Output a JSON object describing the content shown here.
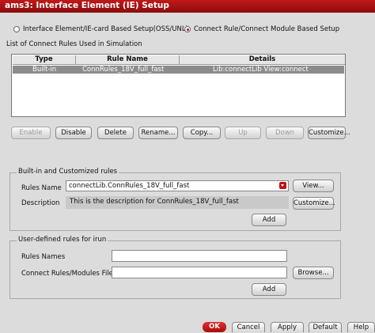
{
  "window": {
    "title": "ams3: Interface Element (IE) Setup"
  },
  "setup_mode": {
    "options": [
      {
        "label": "Interface Element/IE-card Based Setup(OSS/UNL)",
        "selected": false
      },
      {
        "label": "Connect Rule/Connect Module Based Setup",
        "selected": true
      }
    ]
  },
  "connect_rules": {
    "section_title": "List of Connect Rules Used in Simulation",
    "columns": [
      "Type",
      "Rule Name",
      "Details"
    ],
    "rows": [
      {
        "type": "Built-in",
        "rule_name": "ConnRules_18V_full_fast",
        "details": "Lib:connectLib View:connect"
      }
    ],
    "buttons": {
      "enable": "Enable",
      "disable": "Disable",
      "delete": "Delete",
      "rename": "Rename...",
      "copy": "Copy...",
      "up": "Up",
      "down": "Down",
      "customize": "Customize..."
    }
  },
  "builtin_rules": {
    "section_title": "Built-in and Customized rules",
    "rules_name_label": "Rules Name",
    "rules_name_value": "connectLib.ConnRules_18V_full_fast",
    "view_button": "View...",
    "description_label": "Description",
    "description_value": "This is the description for ConnRules_18V_full_fast",
    "customize_button": "Customize...",
    "add_button": "Add"
  },
  "user_rules": {
    "section_title": "User-defined rules for irun",
    "rules_names_label": "Rules Names",
    "rules_names_value": "",
    "connect_files_label": "Connect Rules/Modules Files",
    "connect_files_value": "",
    "browse_button": "Browse...",
    "add_button": "Add"
  },
  "footer": {
    "ok": "OK",
    "cancel": "Cancel",
    "apply": "Apply",
    "default": "Default",
    "help": "Help"
  }
}
